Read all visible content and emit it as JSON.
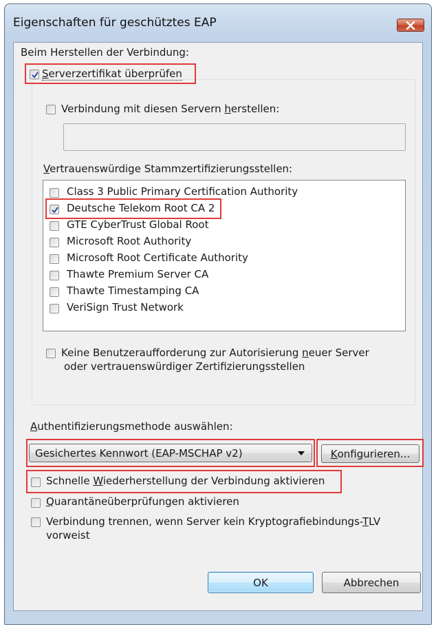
{
  "window": {
    "title": "Eigenschaften für geschütztes EAP"
  },
  "connection": {
    "heading": "Beim Herstellen der Verbindung:",
    "verify_cert": {
      "label_pre": "",
      "label_u": "S",
      "label_post": "erverzertifikat überprüfen",
      "checked": true
    },
    "connect_servers": {
      "label_pre": "Verbindung mit diesen Servern ",
      "label_u": "h",
      "label_post": "erstellen:",
      "checked": false
    },
    "servers_value": "",
    "trusted_ca_heading_u": "V",
    "trusted_ca_heading_post": "ertrauenswürdige Stammzertifizierungsstellen:",
    "ca_list": [
      {
        "label": "Class 3 Public Primary Certification Authority",
        "checked": false
      },
      {
        "label": "Deutsche Telekom Root CA 2",
        "checked": true
      },
      {
        "label": "GTE CyberTrust Global Root",
        "checked": false
      },
      {
        "label": "Microsoft Root Authority",
        "checked": false
      },
      {
        "label": "Microsoft Root Certificate Authority",
        "checked": false
      },
      {
        "label": "Thawte Premium Server CA",
        "checked": false
      },
      {
        "label": "Thawte Timestamping CA",
        "checked": false
      },
      {
        "label": "VeriSign Trust Network",
        "checked": false
      }
    ],
    "no_prompt": {
      "line1_pre": "Keine Benutzeraufforderung zur Autorisierung ",
      "line1_u": "n",
      "line1_post": "euer Server",
      "line2": "oder vertrauenswürdiger Zertifizierungsstellen",
      "checked": false
    }
  },
  "auth": {
    "heading_u": "A",
    "heading_post": "uthentifizierungsmethode auswählen:",
    "method_selected": "Gesichertes Kennwort (EAP-MSCHAP v2)",
    "configure_u": "K",
    "configure_post": "onfigurieren...",
    "fast_reconnect": {
      "pre": "Schnelle ",
      "u": "W",
      "post": "iederherstellung der Verbindung aktivieren",
      "checked": false
    },
    "quarantine": {
      "pre": "",
      "u": "Q",
      "post": "uarantäneüberprüfungen aktivieren",
      "checked": false
    },
    "disconnect": {
      "line1_pre": "Verbindung trennen, wenn Server kein Kryptografiebindungs-",
      "line1_u": "T",
      "line1_post": "LV",
      "line2": "vorweist",
      "checked": false
    }
  },
  "buttons": {
    "ok": "OK",
    "cancel": "Abbrechen"
  },
  "colors": {
    "highlight_border": "#e03a3a",
    "check_mark": "#2a4f9e",
    "close_button": "#c94a31"
  }
}
